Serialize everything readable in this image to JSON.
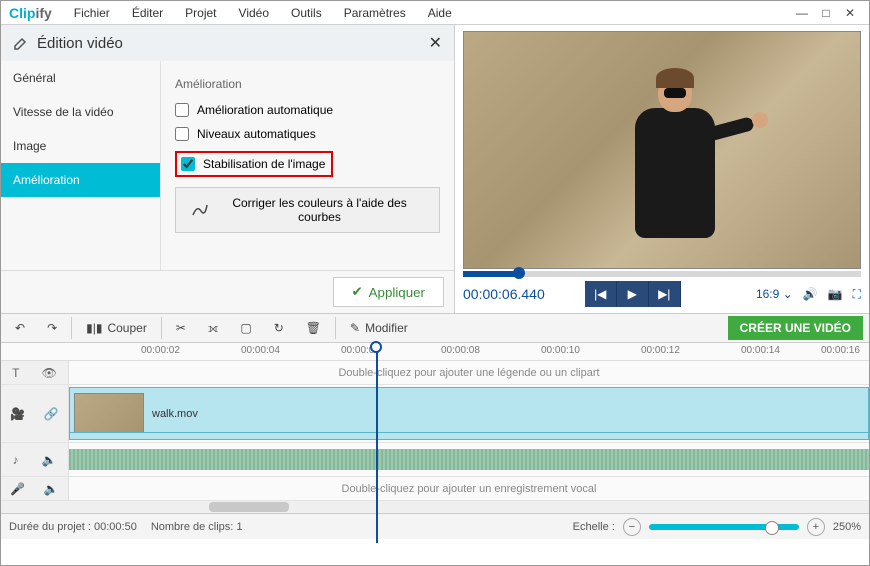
{
  "app": {
    "logo_main": "Clip",
    "logo_suffix": "ify"
  },
  "menu": [
    "Fichier",
    "Éditer",
    "Projet",
    "Vidéo",
    "Outils",
    "Paramètres",
    "Aide"
  ],
  "panel": {
    "title": "Édition vidéo",
    "tabs": [
      "Général",
      "Vitesse de la vidéo",
      "Image",
      "Amélioration"
    ],
    "active_tab": 3,
    "section": "Amélioration",
    "opt_auto_enhance": "Amélioration automatique",
    "opt_auto_levels": "Niveaux automatiques",
    "opt_stabilize": "Stabilisation de l'image",
    "curves_btn": "Corriger les couleurs à l'aide des courbes",
    "apply": "Appliquer"
  },
  "preview": {
    "timecode": "00:00:06.440",
    "aspect": "16:9"
  },
  "toolbar": {
    "cut": "Couper",
    "edit": "Modifier",
    "create": "CRÉER UNE VIDÉO"
  },
  "ruler": [
    "00:00:02",
    "00:00:04",
    "00:00:06",
    "00:00:08",
    "00:00:10",
    "00:00:12",
    "00:00:14",
    "00:00:16"
  ],
  "tracks": {
    "caption_hint": "Double-cliquez pour ajouter une légende ou un clipart",
    "voice_hint": "Double-cliquez pour ajouter un enregistrement vocal",
    "clip_name": "walk.mov"
  },
  "status": {
    "duration_label": "Durée du projet :",
    "duration_value": "00:00:50",
    "clips_label": "Nombre de clips:",
    "clips_value": "1",
    "scale_label": "Echelle :",
    "scale_value": "250%"
  }
}
